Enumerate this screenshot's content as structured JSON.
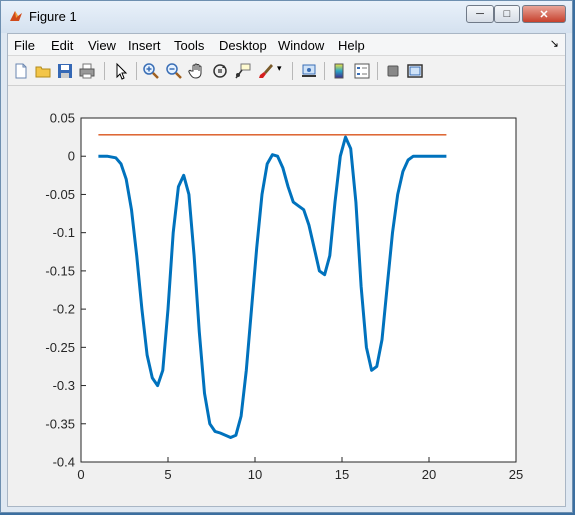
{
  "window": {
    "title": "Figure 1"
  },
  "menu": [
    "File",
    "Edit",
    "View",
    "Insert",
    "Tools",
    "Desktop",
    "Window",
    "Help"
  ],
  "toolbar_icons": [
    "new-figure-icon",
    "open-file-icon",
    "save-icon",
    "print-icon",
    "pointer-icon",
    "zoom-in-icon",
    "zoom-out-icon",
    "pan-hand-icon",
    "rotate-3d-icon",
    "data-cursor-icon",
    "brush-icon",
    "link-plot-icon",
    "colorbar-icon",
    "legend-icon",
    "hide-plot-tools-icon",
    "show-plot-tools-icon"
  ],
  "chart_data": {
    "type": "line",
    "xlim": [
      0,
      25
    ],
    "ylim": [
      -0.4,
      0.05
    ],
    "x_ticks": [
      "0",
      "5",
      "10",
      "15",
      "20",
      "25"
    ],
    "y_ticks": [
      "0.05",
      "0",
      "-0.05",
      "-0.1",
      "-0.15",
      "-0.2",
      "-0.25",
      "-0.3",
      "-0.35",
      "-0.4"
    ],
    "series": [
      {
        "color": "#0072bd",
        "x": [
          1,
          1.5,
          2,
          2.3,
          2.6,
          2.9,
          3.2,
          3.5,
          3.8,
          4.1,
          4.4,
          4.7,
          5.0,
          5.3,
          5.6,
          5.9,
          6.2,
          6.5,
          6.8,
          7.1,
          7.4,
          7.7,
          8.0,
          8.3,
          8.6,
          8.9,
          9.2,
          9.5,
          9.8,
          10.1,
          10.4,
          10.7,
          11.0,
          11.3,
          11.6,
          11.9,
          12.2,
          12.5,
          12.8,
          13.1,
          13.4,
          13.7,
          14.0,
          14.3,
          14.6,
          14.9,
          15.2,
          15.5,
          15.8,
          16.1,
          16.4,
          16.7,
          17.0,
          17.3,
          17.6,
          17.9,
          18.2,
          18.5,
          18.8,
          19.1,
          19.4,
          19.7,
          20,
          20.5,
          21
        ],
        "y": [
          0,
          0,
          -0.002,
          -0.01,
          -0.03,
          -0.07,
          -0.13,
          -0.2,
          -0.26,
          -0.29,
          -0.3,
          -0.28,
          -0.2,
          -0.1,
          -0.04,
          -0.025,
          -0.05,
          -0.13,
          -0.23,
          -0.31,
          -0.35,
          -0.36,
          -0.362,
          -0.365,
          -0.368,
          -0.365,
          -0.34,
          -0.28,
          -0.2,
          -0.12,
          -0.05,
          -0.01,
          0.002,
          0,
          -0.015,
          -0.04,
          -0.06,
          -0.065,
          -0.07,
          -0.09,
          -0.12,
          -0.15,
          -0.155,
          -0.13,
          -0.06,
          0,
          0.025,
          0.01,
          -0.06,
          -0.17,
          -0.25,
          -0.28,
          -0.275,
          -0.24,
          -0.17,
          -0.1,
          -0.05,
          -0.02,
          -0.005,
          0,
          0,
          0,
          0,
          0,
          0
        ]
      },
      {
        "color": "#d95319",
        "x": [
          1,
          21
        ],
        "y": [
          0.028,
          0.028
        ]
      }
    ]
  }
}
